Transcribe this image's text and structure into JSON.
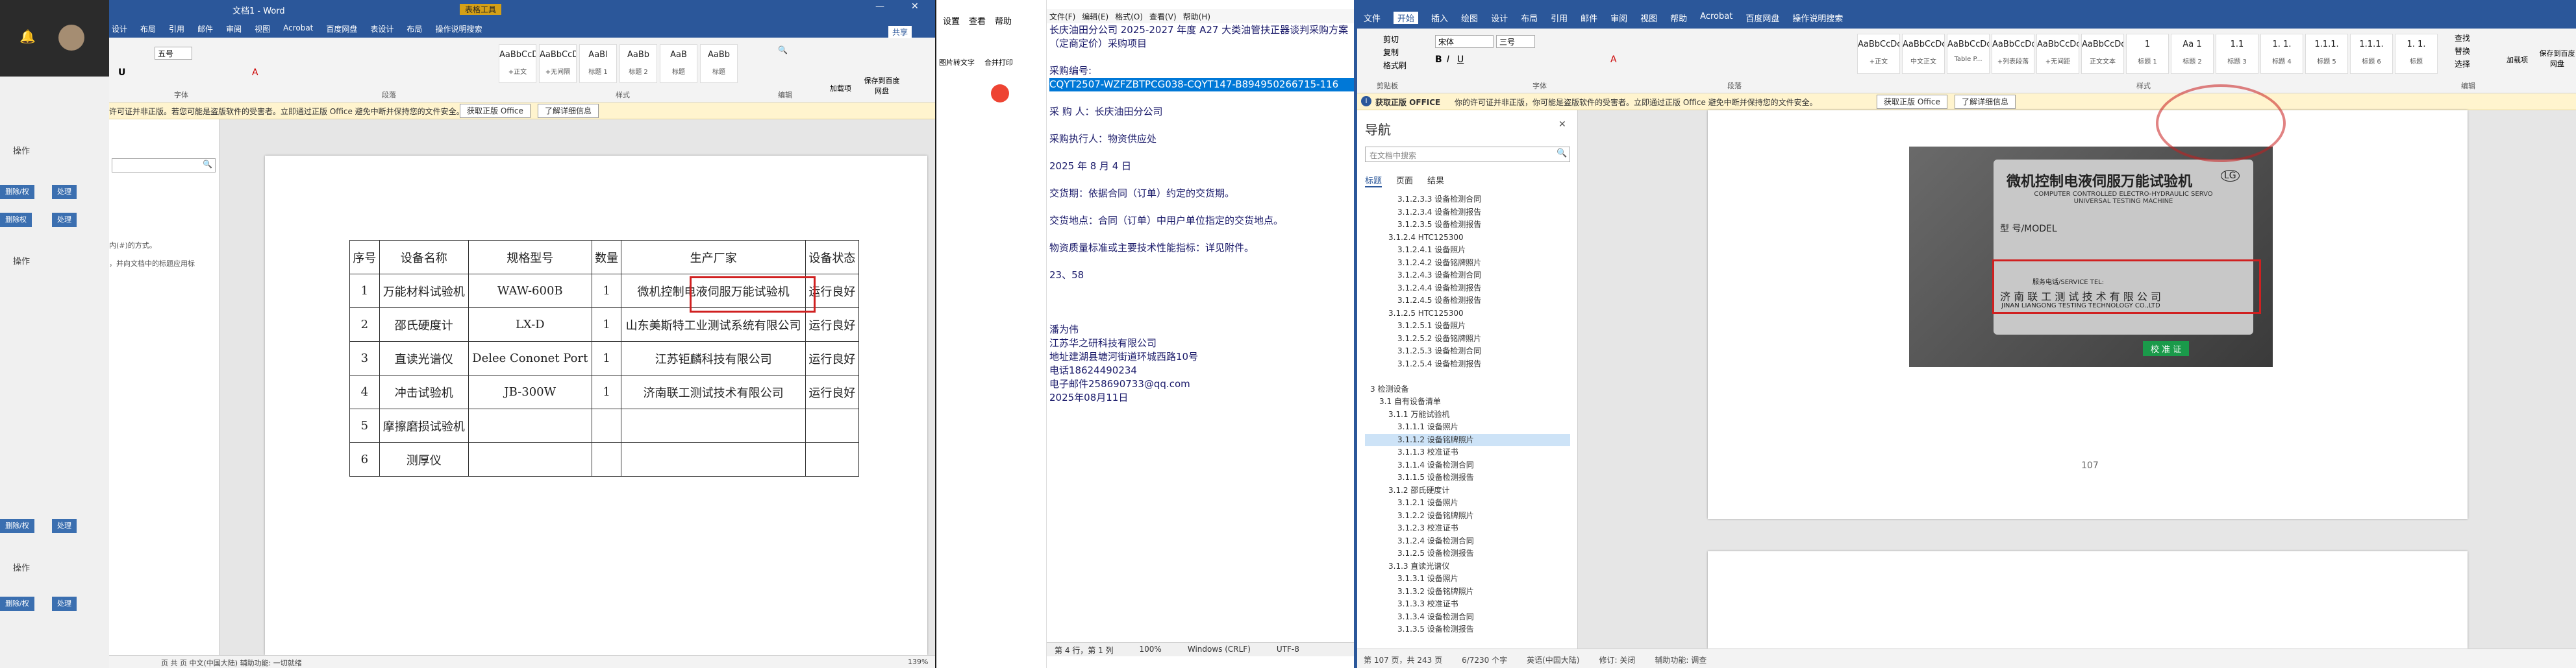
{
  "left": {
    "label1": "操作",
    "label2": "操作",
    "label3": "操作",
    "btn1": "删除/权",
    "btn2": "处理",
    "btn3": "删除权",
    "btn4": "处理"
  },
  "word1": {
    "title": "文档1 - Word",
    "tabs": [
      "设计",
      "布局",
      "引用",
      "邮件",
      "审阅",
      "视图",
      "Acrobat",
      "百度网盘",
      "表设计",
      "布局",
      "操作说明搜索"
    ],
    "table_tools": "表格工具",
    "font_name": "",
    "font_size": "五号",
    "styles": [
      "AaBbCcDc",
      "AaBbCcDc",
      "AaBl",
      "AaBb",
      "AaB",
      "AaBb"
    ],
    "style_names": [
      "+正文",
      "+无间隔",
      "标题 1",
      "标题 2",
      "标题",
      "标题"
    ],
    "group_labels": [
      "字体",
      "段落",
      "样式",
      "编辑"
    ],
    "extra": [
      "加载项",
      "保存到百度网盘"
    ],
    "share": "共享",
    "msg": "许可证并非正版。若您可能是盗版软件的受害者。立即通过正版 Office 避免中断并保持您的文件安全。",
    "msg_btn1": "获取正版 Office",
    "msg_btn2": "了解详细信息",
    "side_text1": "内(#)的方式。",
    "side_text2": "，并向文档中的标题应用标",
    "table": {
      "headers": [
        "序号",
        "设备名称",
        "规格型号",
        "数量",
        "生产厂家",
        "设备状态"
      ],
      "rows": [
        [
          "1",
          "万能材料试验机",
          "WAW-600B",
          "1",
          "微机控制电液伺服万能试验机",
          "运行良好"
        ],
        [
          "2",
          "邵氏硬度计",
          "LX-D",
          "1",
          "山东美斯特工业测试系统有限公司",
          "运行良好"
        ],
        [
          "3",
          "直读光谱仪",
          "Delee Cononet Port",
          "1",
          "江苏钜麟科技有限公司",
          "运行良好"
        ],
        [
          "4",
          "冲击试验机",
          "JB-300W",
          "1",
          "济南联工测试技术有限公司",
          "运行良好"
        ],
        [
          "5",
          "摩擦磨损试验机",
          "",
          "",
          "",
          ""
        ],
        [
          "6",
          "测厚仪",
          "",
          "",
          "",
          ""
        ]
      ]
    },
    "status": "页  共 页  中文(中国大陆)  辅助功能: 一切就绪",
    "zoom": "139%"
  },
  "notepad": {
    "menu": [
      "文件(F)",
      "编辑(E)",
      "格式(O)",
      "查看(V)",
      "帮助(H)"
    ],
    "left_menu": [
      "设置",
      "查看",
      "帮助"
    ],
    "left_tools": [
      "图片转文字",
      "合并打印"
    ],
    "lines": [
      "长庆油田分公司 2025-2027 年度 A27 大类油管扶正器谈判采购方案（定商定价）采购项目",
      "",
      "采购编号:",
      "CQYT2507-WZFZBTPCG038-CQYT147-B894950266715-116",
      "",
      "采 购 人：长庆油田分公司",
      "",
      "采购执行人：物资供应处",
      "",
      "2025 年 8 月 4 日",
      "",
      "交货期：依据合同（订单）约定的交货期。",
      "",
      "交货地点：合同（订单）中用户单位指定的交货地点。",
      "",
      "物资质量标准或主要技术性能指标：详见附件。",
      "",
      "23、58",
      "",
      "",
      "",
      "潘为伟",
      "江苏华之研科技有限公司",
      "地址建湖县塘河街道环城西路10号",
      "电话18624490234",
      "电子邮件258690733@qq.com",
      "2025年08月11日"
    ],
    "status": [
      "第 4 行，第 1 列",
      "100%",
      "Windows (CRLF)",
      "UTF-8"
    ]
  },
  "word2": {
    "tabs": [
      "文件",
      "开始",
      "插入",
      "绘图",
      "设计",
      "布局",
      "引用",
      "邮件",
      "审阅",
      "视图",
      "帮助",
      "Acrobat",
      "百度网盘",
      "操作说明搜索"
    ],
    "font_name": "宋体",
    "font_size": "三号",
    "clipboard": [
      "剪切",
      "复制",
      "格式刷"
    ],
    "styles": [
      "AaBbCcDc",
      "AaBbCcDc",
      "AaBbCcDc",
      "AaBbCcDc",
      "AaBbCcDc",
      "AaBbCcDd",
      "1",
      "Aa 1",
      "1.1",
      "1. 1.",
      "1.1.1.",
      "1.1.1.",
      "1. 1."
    ],
    "style_names": [
      "+正文",
      "中文正文",
      "Table P...",
      "+列表段落",
      "+无间距",
      "正文文本",
      "标题 1",
      "标题 2",
      "标题 3",
      "标题 4",
      "标题 5",
      "标题 6",
      "标题"
    ],
    "find": [
      "查找",
      "替换",
      "选择"
    ],
    "extra": [
      "加载项",
      "保存到百度网盘"
    ],
    "groups": [
      "剪贴板",
      "字体",
      "段落",
      "样式",
      "编辑"
    ],
    "msg_title": "获取正版 OFFICE",
    "msg": "你的许可证并非正版，你可能是盗版软件的受害者。立即通过正版 Office 避免中断并保持您的文件安全。",
    "msg_btn1": "获取正版 Office",
    "msg_btn2": "了解详细信息",
    "nav": {
      "title": "导航",
      "search": "在文档中搜索",
      "tabs": [
        "标题",
        "页面",
        "结果"
      ],
      "items": [
        [
          "3.1.2.3.3 设备检测合同",
          0
        ],
        [
          "3.1.2.3.4 设备检测报告",
          0
        ],
        [
          "3.1.2.3.5 设备检测报告",
          0
        ],
        [
          "3.1.2.4 HTC125300",
          -1
        ],
        [
          "3.1.2.4.1 设备照片",
          0
        ],
        [
          "3.1.2.4.2 设备铭牌照片",
          0
        ],
        [
          "3.1.2.4.3 设备检测合同",
          0
        ],
        [
          "3.1.2.4.4 设备检测报告",
          0
        ],
        [
          "3.1.2.4.5 设备检测报告",
          0
        ],
        [
          "3.1.2.5 HTC125300",
          -1
        ],
        [
          "3.1.2.5.1 设备照片",
          0
        ],
        [
          "3.1.2.5.2 设备铭牌照片",
          0
        ],
        [
          "3.1.2.5.3 设备检测合同",
          0
        ],
        [
          "3.1.2.5.4 设备检测报告",
          0
        ],
        [
          "",
          0
        ],
        [
          "3 检测设备",
          -3
        ],
        [
          "3.1 自有设备清单",
          -2
        ],
        [
          "3.1.1 万能试验机",
          -1
        ],
        [
          "3.1.1.1 设备照片",
          0
        ],
        [
          "3.1.1.2 设备铭牌照片",
          0
        ],
        [
          "3.1.1.3 校准证书",
          0
        ],
        [
          "3.1.1.4 设备检测合同",
          0
        ],
        [
          "3.1.1.5 设备检测报告",
          0
        ],
        [
          "3.1.2 邵氏硬度计",
          -1
        ],
        [
          "3.1.2.1 设备照片",
          0
        ],
        [
          "3.1.2.2 设备铭牌照片",
          0
        ],
        [
          "3.1.2.3 校准证书",
          0
        ],
        [
          "3.1.2.4 设备检测合同",
          0
        ],
        [
          "3.1.2.5 设备检测报告",
          0
        ],
        [
          "3.1.3 直读光谱仪",
          -1
        ],
        [
          "3.1.3.1 设备照片",
          0
        ],
        [
          "3.1.3.2 设备铭牌照片",
          0
        ],
        [
          "3.1.3.3 校准证书",
          0
        ],
        [
          "3.1.3.4 设备检测合同",
          0
        ],
        [
          "3.1.3.5 设备检测报告",
          0
        ]
      ],
      "selected_index": 19
    },
    "photo": {
      "title": "微机控制电液伺服万能试验机",
      "subtitle": "COMPUTER CONTROLLED ELECTRO-HYDRAULIC SERVO UNIVERSAL TESTING MACHINE",
      "model_label": "型 号/MODEL",
      "service": "服务电话/SERVICE TEL: ",
      "maker": "济 南 联 工 测 试 技 术 有 限 公 司",
      "maker_en": "JINAN LIANGONG TESTING TECHNOLOGY CO.,LTD",
      "badge": "校 准 证",
      "logo": "LG"
    },
    "page_num": "107",
    "status": [
      "第 107 页，共 243 页",
      "6/7230 个字",
      "英语(中国大陆)",
      "修订: 关闭",
      "辅助功能: 调查"
    ]
  },
  "colors": {
    "word_blue": "#2b579a",
    "highlight_red": "#d02020",
    "link": "#1a1a6a",
    "selection": "#0078d7"
  }
}
